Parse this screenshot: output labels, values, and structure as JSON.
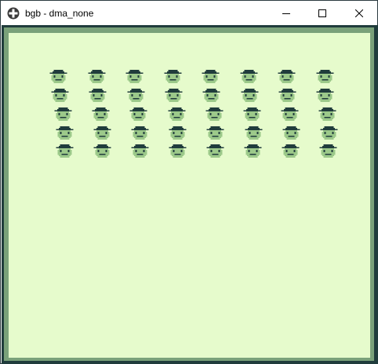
{
  "window": {
    "title": "bgb - dma_none",
    "app_icon": "plus-cross-icon",
    "controls": [
      "minimize-icon",
      "maximize-icon",
      "close-icon"
    ]
  },
  "game": {
    "palette": {
      "darkest": "#203c3c",
      "dark": "#3f6a5c",
      "light": "#9cc98a",
      "lightest": "#e6fbcc",
      "frame": "#7aa17a"
    },
    "sprite_rows": 5,
    "sprites_per_row": 8,
    "sprite_name": "green-face-sprite"
  }
}
